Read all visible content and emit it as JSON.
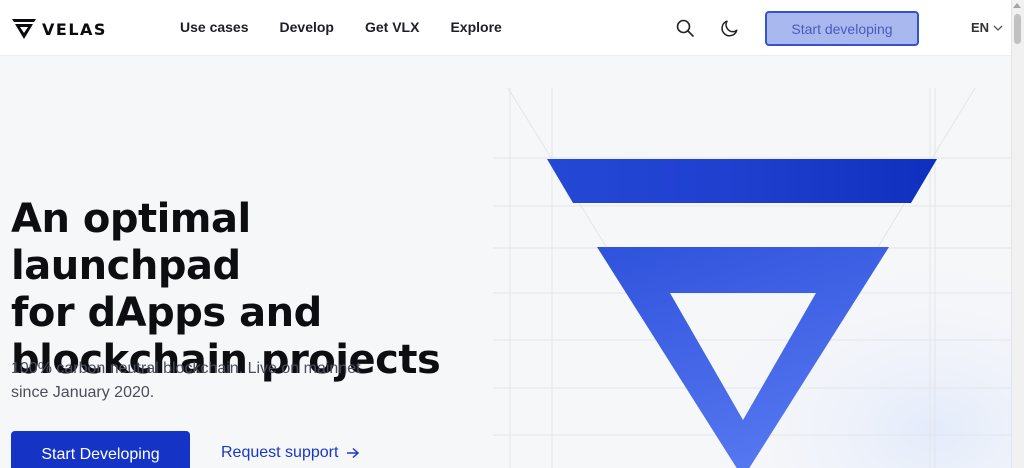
{
  "header": {
    "logo_text": "VELAS",
    "nav": [
      "Use cases",
      "Develop",
      "Get VLX",
      "Explore"
    ],
    "cta_label": "Start developing",
    "lang": "EN"
  },
  "hero": {
    "title_lines": [
      "An optimal launchpad",
      "for dApps and",
      "blockchain projects"
    ],
    "subtitle": "100% carbon neutral blockchain. Live on mainnet since January 2020.",
    "primary_cta": "Start Developing",
    "secondary_cta": "Request support"
  },
  "colors": {
    "accent": "#1533c4",
    "link": "#1a36c8",
    "logo_blue": "#2a4fdc",
    "cta_top_bg": "#a9b8ef",
    "cta_top_border": "#3852c9"
  },
  "icons": [
    "velas-logo-icon",
    "search-icon",
    "moon-icon",
    "chevron-down-icon",
    "arrow-right-icon"
  ]
}
